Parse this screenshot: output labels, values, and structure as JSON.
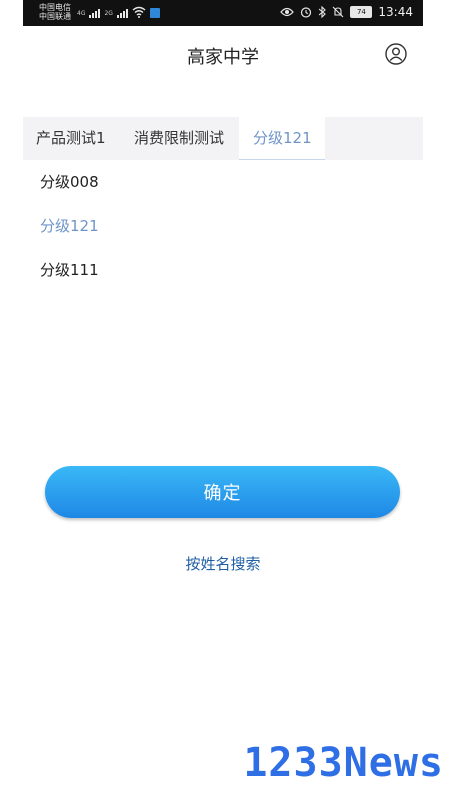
{
  "status_bar": {
    "carrier1": "中国电信",
    "carrier2": "中国联通",
    "net1": "4G",
    "net2": "2G",
    "battery": "74",
    "time": "13:44"
  },
  "header": {
    "title": "高家中学"
  },
  "tabs": [
    {
      "label": "产品测试1",
      "active": false
    },
    {
      "label": "消费限制测试",
      "active": false
    },
    {
      "label": "分级121",
      "active": true
    }
  ],
  "list": [
    {
      "label": "分级008",
      "selected": false
    },
    {
      "label": "分级121",
      "selected": true
    },
    {
      "label": "分级111",
      "selected": false
    }
  ],
  "actions": {
    "confirm_label": "确定",
    "search_by_name_label": "按姓名搜索"
  },
  "watermark": {
    "text": "1233News"
  },
  "colors": {
    "accent": "#6f95c7",
    "button_top": "#3ab8f7",
    "button_bottom": "#1e88e5",
    "link": "#1f5fa6",
    "watermark": "#2f6fe6"
  },
  "icons": {
    "profile": "user-circle-icon",
    "wifi": "wifi-icon",
    "eye": "eye-comfort-icon",
    "alarm": "alarm-icon",
    "bluetooth": "bluetooth-icon",
    "mute": "bell-off-icon"
  }
}
